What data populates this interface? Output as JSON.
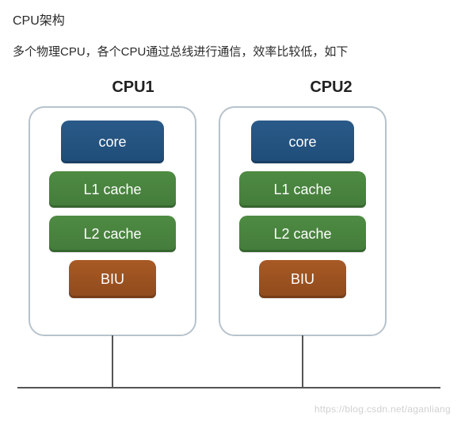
{
  "heading": "CPU架构",
  "description": "多个物理CPU，各个CPU通过总线进行通信，效率比较低，如下",
  "cpus": [
    {
      "label": "CPU1",
      "core": "core",
      "l1": "L1 cache",
      "l2": "L2 cache",
      "biu": "BIU"
    },
    {
      "label": "CPU2",
      "core": "core",
      "l1": "L1 cache",
      "l2": "L2 cache",
      "biu": "BIU"
    }
  ],
  "watermark": "https://blog.csdn.net/aganliang"
}
